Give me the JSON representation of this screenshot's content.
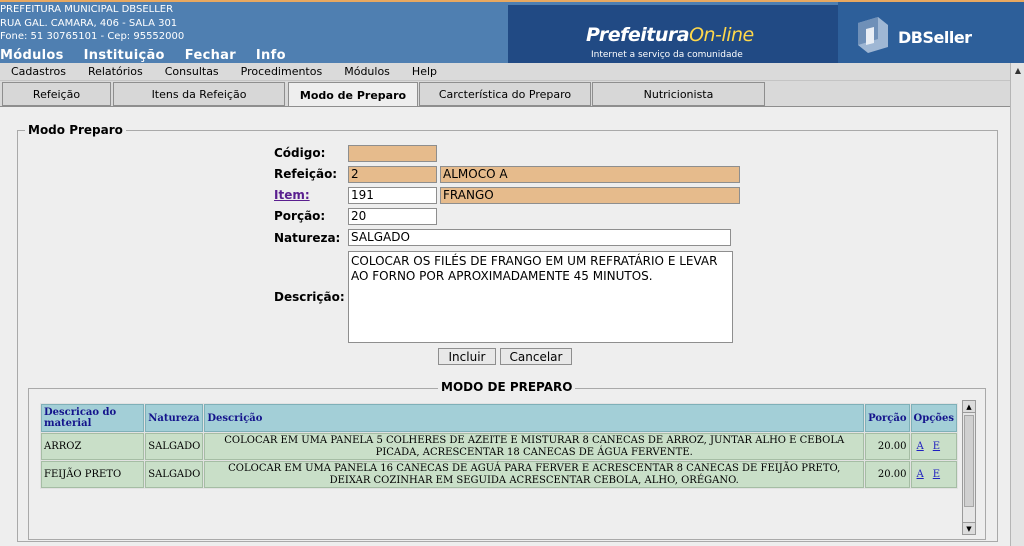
{
  "header": {
    "org_name": "PREFEITURA MUNICIPAL DBSELLER",
    "org_address": "RUA GAL. CAMARA, 406 - SALA 301",
    "org_phone": "Fone: 51 30765101  -  Cep: 95552000",
    "top_menu": [
      "Módulos",
      "Instituição",
      "Fechar",
      "Info"
    ],
    "logo_prefeitura": "Prefeitura",
    "logo_online": "On-line",
    "logo_tagline": "Internet a serviço da comunidade",
    "logo_dbseller": "DBSeller"
  },
  "menubar": [
    "Cadastros",
    "Relatórios",
    "Consultas",
    "Procedimentos",
    "Módulos",
    "Help"
  ],
  "tabs": [
    "Refeição",
    "Itens da Refeição",
    "Modo de Preparo",
    "Carcterística do Preparo",
    "Nutricionista"
  ],
  "active_tab": "Modo de Preparo",
  "form": {
    "legend": "Modo Preparo",
    "codigo_label": "Código:",
    "codigo_value": "",
    "refeicao_label": "Refeição:",
    "refeicao_code": "2",
    "refeicao_name": "ALMOCO A",
    "item_label": "Item:",
    "item_code": "191",
    "item_name": "FRANGO",
    "porcao_label": "Porção:",
    "porcao_value": "20",
    "natureza_label": "Natureza:",
    "natureza_value": "SALGADO",
    "descricao_label": "Descrição:",
    "descricao_value": "COLOCAR OS FILÉS DE FRANGO EM UM REFRATÁRIO E LEVAR AO FORNO POR APROXIMADAMENTE 45 MINUTOS.",
    "incluir_label": "Incluir",
    "cancelar_label": "Cancelar"
  },
  "grid": {
    "legend": "MODO DE PREPARO",
    "headers": [
      "Descricao do material",
      "Natureza",
      "Descrição",
      "Porção",
      "Opções"
    ],
    "rows": [
      {
        "material": "ARROZ",
        "natureza": "SALGADO",
        "descricao": "COLOCAR EM UMA PANELA 5 COLHERES DE AZEITE E MISTURAR 8 CANECAS DE ARROZ, JUNTAR ALHO E CEBOLA PICADA, ACRESCENTAR 18 CANECAS DE ÁGUA FERVENTE.",
        "porcao": "20.00",
        "opt_a": "A",
        "opt_e": "E"
      },
      {
        "material": "FEIJÃO PRETO",
        "natureza": "SALGADO",
        "descricao": "COLOCAR EM UMA PANELA 16 CANECAS DE AGUÁ PARA FERVER E ACRESCENTAR 8 CANECAS DE FEIJÃO PRETO, DEIXAR COZINHAR EM SEGUIDA ACRESCENTAR CEBOLA, ALHO, ORÉGANO.",
        "porcao": "20.00",
        "opt_a": "A",
        "opt_e": "E"
      }
    ]
  },
  "colors": {
    "header_blue": "#4f7fb1",
    "readonly_field": "#e6bb8c",
    "grid_header": "#a3cfd7",
    "grid_row": "#c9dfc8"
  }
}
